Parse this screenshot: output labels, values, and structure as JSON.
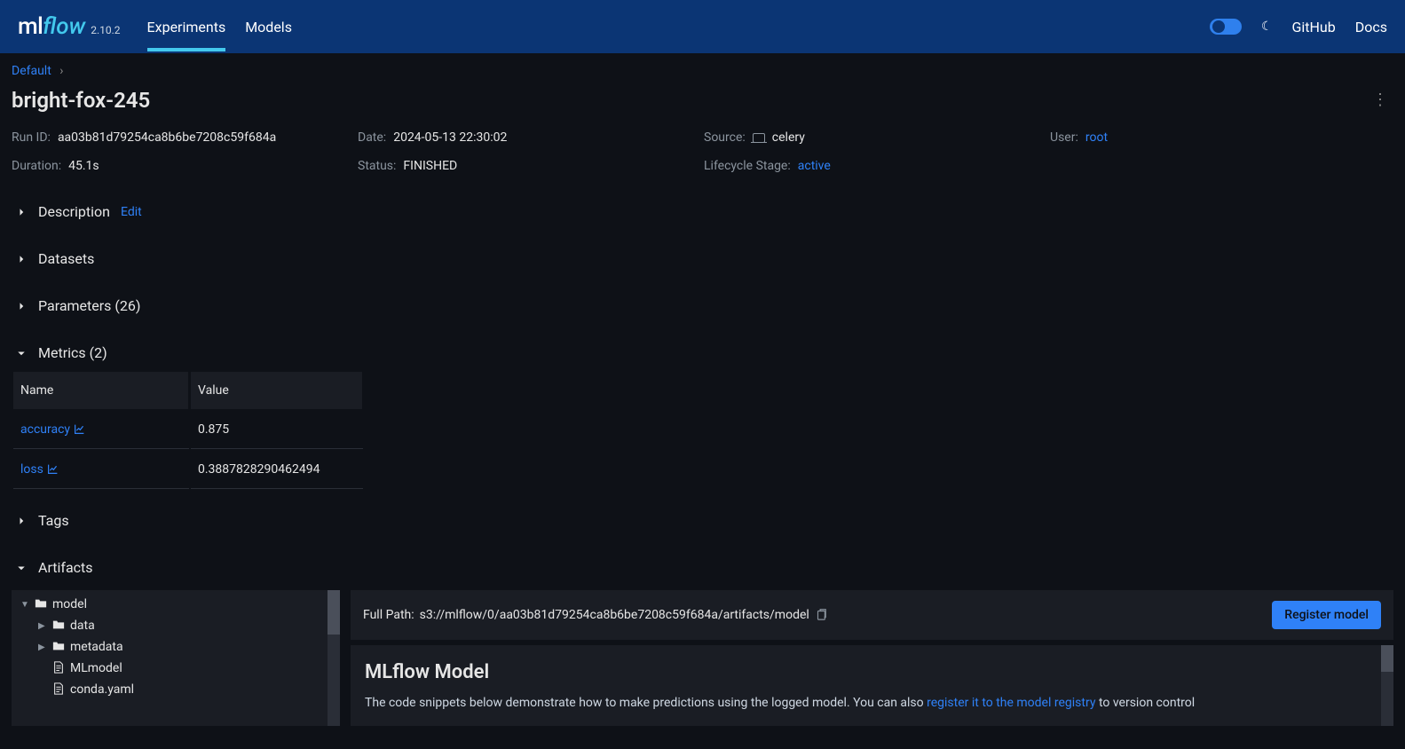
{
  "header": {
    "logo_ml": "ml",
    "logo_flow": "flow",
    "version": "2.10.2",
    "nav": {
      "experiments": "Experiments",
      "models": "Models"
    },
    "links": {
      "github": "GitHub",
      "docs": "Docs"
    }
  },
  "breadcrumb": {
    "parent": "Default"
  },
  "page_title": "bright-fox-245",
  "meta": {
    "run_id_label": "Run ID:",
    "run_id": "aa03b81d79254ca8b6be7208c59f684a",
    "date_label": "Date:",
    "date": "2024-05-13 22:30:02",
    "source_label": "Source:",
    "source": "celery",
    "user_label": "User:",
    "user": "root",
    "duration_label": "Duration:",
    "duration": "45.1s",
    "status_label": "Status:",
    "status": "FINISHED",
    "lifecycle_label": "Lifecycle Stage:",
    "lifecycle": "active"
  },
  "sections": {
    "description": "Description",
    "edit": "Edit",
    "datasets": "Datasets",
    "parameters": "Parameters (26)",
    "metrics": "Metrics (2)",
    "tags": "Tags",
    "artifacts": "Artifacts"
  },
  "metrics_table": {
    "col_name": "Name",
    "col_value": "Value",
    "rows": [
      {
        "name": "accuracy",
        "value": "0.875"
      },
      {
        "name": "loss",
        "value": "0.3887828290462494"
      }
    ]
  },
  "tree": {
    "root": "model",
    "items": [
      {
        "type": "folder",
        "name": "data"
      },
      {
        "type": "folder",
        "name": "metadata"
      },
      {
        "type": "file",
        "name": "MLmodel"
      },
      {
        "type": "file",
        "name": "conda.yaml"
      }
    ]
  },
  "artifact_detail": {
    "path_label": "Full Path:",
    "path": "s3://mlflow/0/aa03b81d79254ca8b6be7208c59f684a/artifacts/model",
    "register_btn": "Register model",
    "card_title": "MLflow Model",
    "card_text_prefix": "The code snippets below demonstrate how to make predictions using the logged model. You can also ",
    "card_text_link": "register it to the model registry",
    "card_text_suffix": " to version control"
  }
}
